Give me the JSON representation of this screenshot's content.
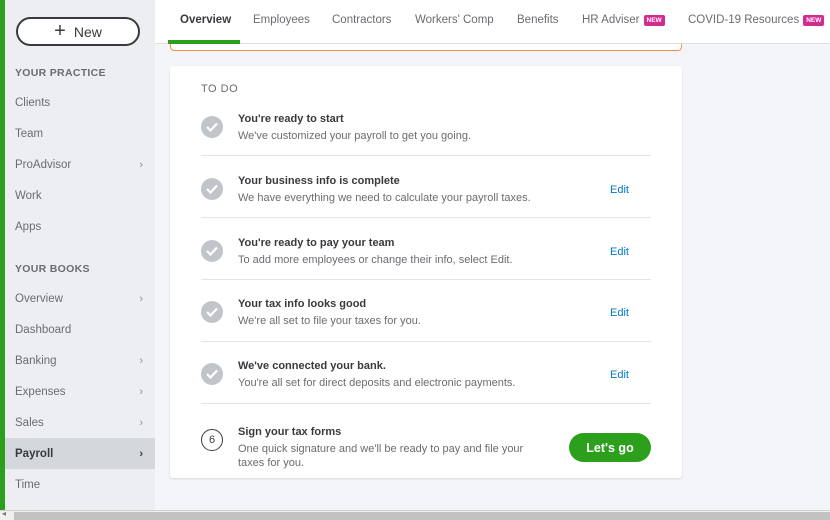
{
  "sidebar": {
    "new_label": "New",
    "practice_heading": "YOUR PRACTICE",
    "practice_items": [
      {
        "label": "Clients"
      },
      {
        "label": "Team"
      },
      {
        "label": "ProAdvisor"
      },
      {
        "label": "Work"
      },
      {
        "label": "Apps"
      }
    ],
    "books_heading": "YOUR BOOKS",
    "books_items": [
      {
        "label": "Overview"
      },
      {
        "label": "Dashboard"
      },
      {
        "label": "Banking"
      },
      {
        "label": "Expenses"
      },
      {
        "label": "Sales"
      },
      {
        "label": "Payroll"
      },
      {
        "label": "Time"
      }
    ]
  },
  "tabs": {
    "items": [
      {
        "label": "Overview"
      },
      {
        "label": "Employees"
      },
      {
        "label": "Contractors"
      },
      {
        "label": "Workers' Comp"
      },
      {
        "label": "Benefits"
      },
      {
        "label": "HR Adviser",
        "badge": "NEW"
      },
      {
        "label": "COVID-19 Resources",
        "badge": "NEW"
      }
    ]
  },
  "card": {
    "heading": "TO DO",
    "tasks": [
      {
        "title": "You're ready to start",
        "desc": "We've customized your payroll to get you going."
      },
      {
        "title": "Your business info is complete",
        "desc": "We have everything we need to calculate your payroll taxes.",
        "action": "Edit"
      },
      {
        "title": "You're ready to pay your team",
        "desc": "To add more employees or change their info, select Edit.",
        "action": "Edit"
      },
      {
        "title": "Your tax info looks good",
        "desc": "We're all set to file your taxes for you.",
        "action": "Edit"
      },
      {
        "title": "We've connected your bank.",
        "desc": "You're all set for direct deposits and electronic payments.",
        "action": "Edit"
      },
      {
        "number": "6",
        "title": "Sign your tax forms",
        "desc": "One quick signature and we'll be ready to pay and file your taxes for you.",
        "action": "Let's go"
      }
    ]
  },
  "colors": {
    "brand_green": "#2ca01c",
    "link_blue": "#0077c5",
    "badge_pink": "#d52b91",
    "alert_orange": "#ff8c4a"
  }
}
